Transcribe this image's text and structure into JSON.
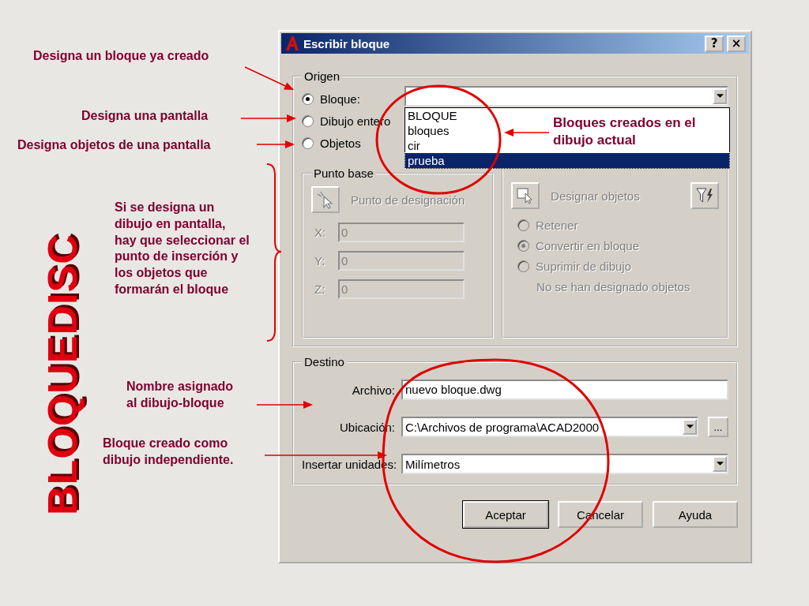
{
  "slide": {
    "vertical_title": "BLOQUEDISC",
    "callouts": [
      {
        "kind": "arrow",
        "text": "Designa un bloque ya creado"
      },
      {
        "kind": "arrow",
        "text": "Designa una pantalla"
      },
      {
        "kind": "arrow",
        "text": "Designa objetos de una pantalla"
      },
      {
        "kind": "arrow",
        "text": "Bloques creados en el dibujo actual"
      },
      {
        "kind": "brace",
        "text": "Si se designa un dibujo en pantalla, hay que seleccionar el punto de inserción y los objetos que formarán el bloque"
      },
      {
        "kind": "arrow",
        "text": "Nombre asignado al dibujo-bloque"
      },
      {
        "kind": "arrow",
        "text": "Bloque creado como dibujo independiente."
      }
    ]
  },
  "dialog": {
    "title": "Escribir bloque",
    "help_button": "?",
    "close_button": "×",
    "origin": {
      "legend": "Origen",
      "options": [
        {
          "label": "Bloque:",
          "selected": true
        },
        {
          "label": "Dibujo entero",
          "selected": false
        },
        {
          "label": "Objetos",
          "selected": false
        }
      ],
      "dropdown_items": [
        {
          "label": "BLOQUE",
          "selected": false
        },
        {
          "label": "bloques",
          "selected": false
        },
        {
          "label": "cir",
          "selected": false
        },
        {
          "label": "prueba",
          "selected": true
        }
      ]
    },
    "base_point": {
      "legend": "Punto base",
      "disabled": true,
      "pick_button": "Punto de designación",
      "fields": [
        {
          "label": "X:",
          "value": "0"
        },
        {
          "label": "Y:",
          "value": "0"
        },
        {
          "label": "Z:",
          "value": "0"
        }
      ]
    },
    "objects": {
      "disabled": true,
      "select_button": "Designar objetos",
      "options": [
        {
          "label": "Retener",
          "selected": false
        },
        {
          "label": "Convertir en bloque",
          "selected": true
        },
        {
          "label": "Suprimir de dibujo",
          "selected": false
        }
      ],
      "status": "No se han designado objetos"
    },
    "destination": {
      "legend": "Destino",
      "file": {
        "label": "Archivo:",
        "value": "nuevo bloque.dwg"
      },
      "location": {
        "label": "Ubicación:",
        "value": "C:\\Archivos de programa\\ACAD2000",
        "browse": "..."
      },
      "units": {
        "label": "Insertar unidades:",
        "value": "Milímetros"
      }
    },
    "buttons": [
      {
        "label": "Aceptar",
        "default": true
      },
      {
        "label": "Cancelar",
        "default": false
      },
      {
        "label": "Ayuda",
        "default": false
      }
    ]
  }
}
